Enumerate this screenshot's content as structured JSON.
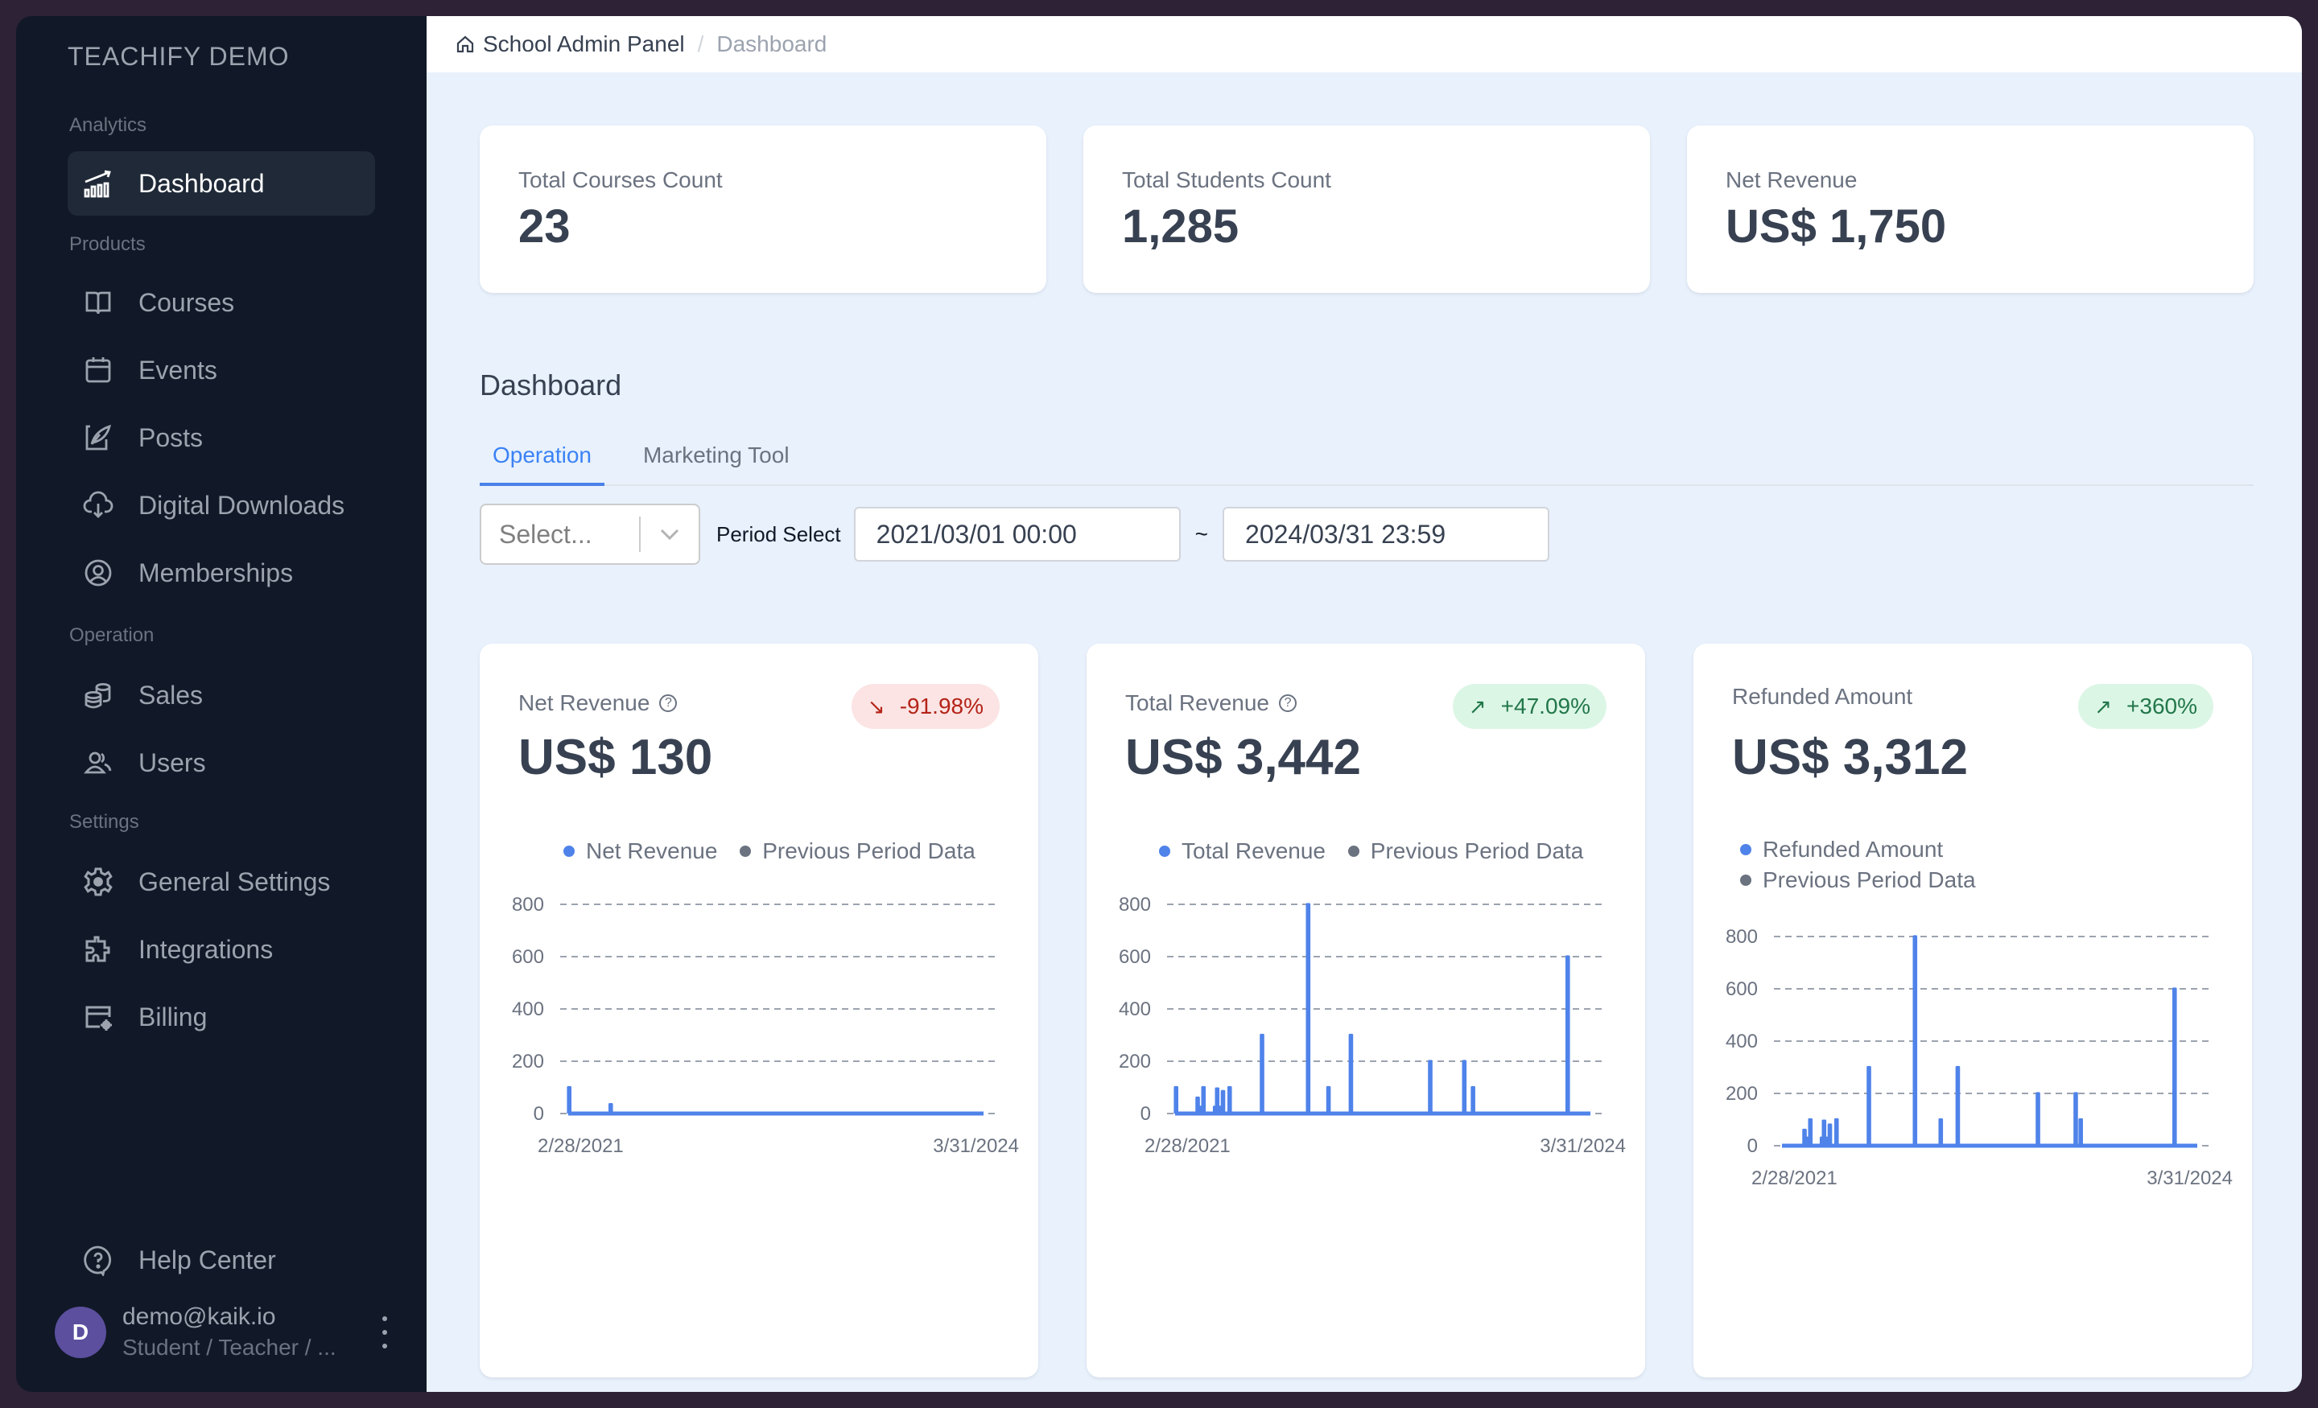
{
  "sidebar": {
    "brand": "TEACHIFY DEMO",
    "sections": [
      {
        "label": "Analytics"
      },
      {
        "label": "Products"
      },
      {
        "label": "Operation"
      },
      {
        "label": "Settings"
      }
    ],
    "items": [
      {
        "label": "Dashboard",
        "icon": "chart-growth-icon",
        "active": true
      },
      {
        "label": "Courses",
        "icon": "book-icon"
      },
      {
        "label": "Events",
        "icon": "calendar-icon"
      },
      {
        "label": "Posts",
        "icon": "quill-icon"
      },
      {
        "label": "Digital Downloads",
        "icon": "cloud-download-icon"
      },
      {
        "label": "Memberships",
        "icon": "user-circle-icon"
      },
      {
        "label": "Sales",
        "icon": "coins-icon"
      },
      {
        "label": "Users",
        "icon": "users-icon"
      },
      {
        "label": "General Settings",
        "icon": "gear-icon"
      },
      {
        "label": "Integrations",
        "icon": "puzzle-icon"
      },
      {
        "label": "Billing",
        "icon": "card-settings-icon"
      }
    ],
    "help": {
      "label": "Help Center",
      "icon": "help-bubble-icon"
    },
    "user": {
      "initial": "D",
      "email": "demo@kaik.io",
      "role": "Student / Teacher / ...",
      "avatar_color": "#5b4f9e"
    }
  },
  "breadcrumb": {
    "home": "School Admin Panel",
    "separator": "/",
    "current": "Dashboard"
  },
  "kpis": [
    {
      "label": "Total Courses Count",
      "value": "23"
    },
    {
      "label": "Total Students Count",
      "value": "1,285"
    },
    {
      "label": "Net Revenue",
      "value": "US$ 1,750"
    }
  ],
  "page_title": "Dashboard",
  "tabs": [
    {
      "label": "Operation",
      "active": true
    },
    {
      "label": "Marketing Tool",
      "active": false
    }
  ],
  "filters": {
    "select_placeholder": "Select...",
    "period_label": "Period Select",
    "start": "2021/03/01 00:00",
    "separator": "~",
    "end": "2024/03/31 23:59"
  },
  "colors": {
    "accent": "#4f83ea",
    "previous": "#6b7280",
    "down_bg": "#fce4e4",
    "down_fg": "#b42318",
    "up_bg": "#dcf6e6",
    "up_fg": "#22774a"
  },
  "cards": [
    {
      "title": "Net Revenue",
      "help": "?",
      "value": "US$ 130",
      "change": "-91.98%",
      "direction": "down",
      "arrow": "↘",
      "legend": [
        "Net Revenue",
        "Previous Period Data"
      ]
    },
    {
      "title": "Total Revenue",
      "help": "?",
      "value": "US$ 3,442",
      "change": "+47.09%",
      "direction": "up",
      "arrow": "↗",
      "legend": [
        "Total Revenue",
        "Previous Period Data"
      ]
    },
    {
      "title": "Refunded Amount",
      "value": "US$ 3,312",
      "change": "+360%",
      "direction": "up",
      "arrow": "↗",
      "legend": [
        "Refunded Amount",
        "Previous Period Data"
      ]
    }
  ],
  "chart_data": [
    {
      "type": "line",
      "title": "Net Revenue",
      "x_range": [
        "2/28/2021",
        "3/31/2024"
      ],
      "x_tick_labels": [
        "2/28/2021",
        "3/31/2024"
      ],
      "ylim": [
        0,
        800
      ],
      "y_ticks": [
        0,
        200,
        400,
        600,
        800
      ],
      "grid": true,
      "legend_position": "top",
      "series": [
        {
          "name": "Net Revenue",
          "spikes": [
            {
              "x": 0.0,
              "y": 100
            },
            {
              "x": 0.1,
              "y": 35
            }
          ]
        },
        {
          "name": "Previous Period Data",
          "spikes": []
        }
      ]
    },
    {
      "type": "line",
      "title": "Total Revenue",
      "x_range": [
        "2/28/2021",
        "3/31/2024"
      ],
      "x_tick_labels": [
        "2/28/2021",
        "3/31/2024"
      ],
      "ylim": [
        0,
        800
      ],
      "y_ticks": [
        0,
        200,
        400,
        600,
        800
      ],
      "grid": true,
      "legend_position": "top",
      "series": [
        {
          "name": "Total Revenue",
          "spikes": [
            {
              "x": 0.0,
              "y": 100
            },
            {
              "x": 0.052,
              "y": 60
            },
            {
              "x": 0.057,
              "y": 25
            },
            {
              "x": 0.066,
              "y": 100
            },
            {
              "x": 0.094,
              "y": 25
            },
            {
              "x": 0.099,
              "y": 95
            },
            {
              "x": 0.104,
              "y": 25
            },
            {
              "x": 0.113,
              "y": 85
            },
            {
              "x": 0.129,
              "y": 100
            },
            {
              "x": 0.207,
              "y": 300
            },
            {
              "x": 0.318,
              "y": 800
            },
            {
              "x": 0.367,
              "y": 100
            },
            {
              "x": 0.421,
              "y": 300
            },
            {
              "x": 0.612,
              "y": 200
            },
            {
              "x": 0.694,
              "y": 200
            },
            {
              "x": 0.715,
              "y": 100
            },
            {
              "x": 0.943,
              "y": 600
            }
          ]
        },
        {
          "name": "Previous Period Data",
          "spikes": []
        }
      ]
    },
    {
      "type": "line",
      "title": "Refunded Amount",
      "x_range": [
        "2/28/2021",
        "3/31/2024"
      ],
      "x_tick_labels": [
        "2/28/2021",
        "3/31/2024"
      ],
      "ylim": [
        0,
        800
      ],
      "y_ticks": [
        0,
        200,
        400,
        600,
        800
      ],
      "grid": true,
      "legend_position": "top-left",
      "series": [
        {
          "name": "Refunded Amount",
          "spikes": [
            {
              "x": 0.052,
              "y": 60
            },
            {
              "x": 0.057,
              "y": 30
            },
            {
              "x": 0.066,
              "y": 100
            },
            {
              "x": 0.094,
              "y": 30
            },
            {
              "x": 0.099,
              "y": 95
            },
            {
              "x": 0.104,
              "y": 30
            },
            {
              "x": 0.113,
              "y": 80
            },
            {
              "x": 0.129,
              "y": 100
            },
            {
              "x": 0.207,
              "y": 300
            },
            {
              "x": 0.318,
              "y": 800
            },
            {
              "x": 0.38,
              "y": 100
            },
            {
              "x": 0.421,
              "y": 300
            },
            {
              "x": 0.614,
              "y": 200
            },
            {
              "x": 0.705,
              "y": 200
            },
            {
              "x": 0.717,
              "y": 100
            },
            {
              "x": 0.943,
              "y": 600
            }
          ]
        },
        {
          "name": "Previous Period Data",
          "spikes": []
        }
      ]
    }
  ]
}
